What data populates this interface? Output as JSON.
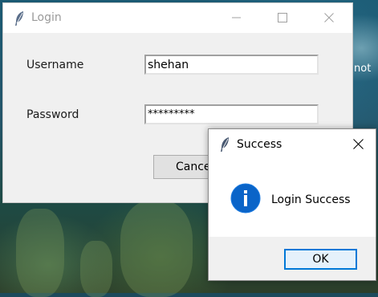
{
  "desktop": {
    "edge_text": "not"
  },
  "login_window": {
    "title": "Login",
    "icon": "feather-icon",
    "controls": {
      "minimize_icon": "minimize-icon",
      "maximize_icon": "maximize-icon",
      "close_icon": "close-icon"
    },
    "username_label": "Username",
    "username_value": "shehan",
    "password_label": "Password",
    "password_value": "*********",
    "cancel_button_label": "Cancel"
  },
  "success_dialog": {
    "title": "Success",
    "icon": "feather-icon",
    "close_icon": "close-icon",
    "info_icon": "info-icon",
    "message": "Login Success",
    "ok_button_label": "OK"
  },
  "colors": {
    "dialog_accent": "#0078d7",
    "info_icon_fill": "#0a64c8",
    "window_background": "#f0f0f0"
  }
}
